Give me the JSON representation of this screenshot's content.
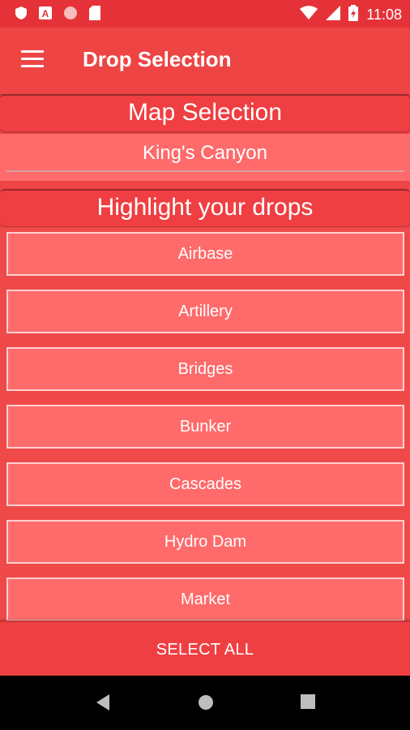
{
  "status_bar": {
    "time": "11:08",
    "left_icons": [
      "shield-icon",
      "text-a-icon",
      "circle-icon",
      "sd-card-icon"
    ],
    "right_icons": [
      "wifi-icon",
      "signal-icon",
      "battery-icon"
    ]
  },
  "app_bar": {
    "title": "Drop Selection",
    "menu_icon": "hamburger-menu-icon"
  },
  "map_section": {
    "header": "Map Selection",
    "selected_map": "King's Canyon"
  },
  "drops_section": {
    "header": "Highlight your drops",
    "items": [
      {
        "label": "Airbase"
      },
      {
        "label": "Artillery"
      },
      {
        "label": "Bridges"
      },
      {
        "label": "Bunker"
      },
      {
        "label": "Cascades"
      },
      {
        "label": "Hydro Dam"
      },
      {
        "label": "Market"
      }
    ]
  },
  "select_all_label": "SELECT ALL",
  "nav_bar": {
    "icons": [
      "back-icon",
      "home-icon",
      "recents-icon"
    ]
  },
  "colors": {
    "primary": "#ee4444",
    "status_bar": "#e53238",
    "button_fill": "#ff6a6a",
    "nav_bar": "#000000"
  }
}
